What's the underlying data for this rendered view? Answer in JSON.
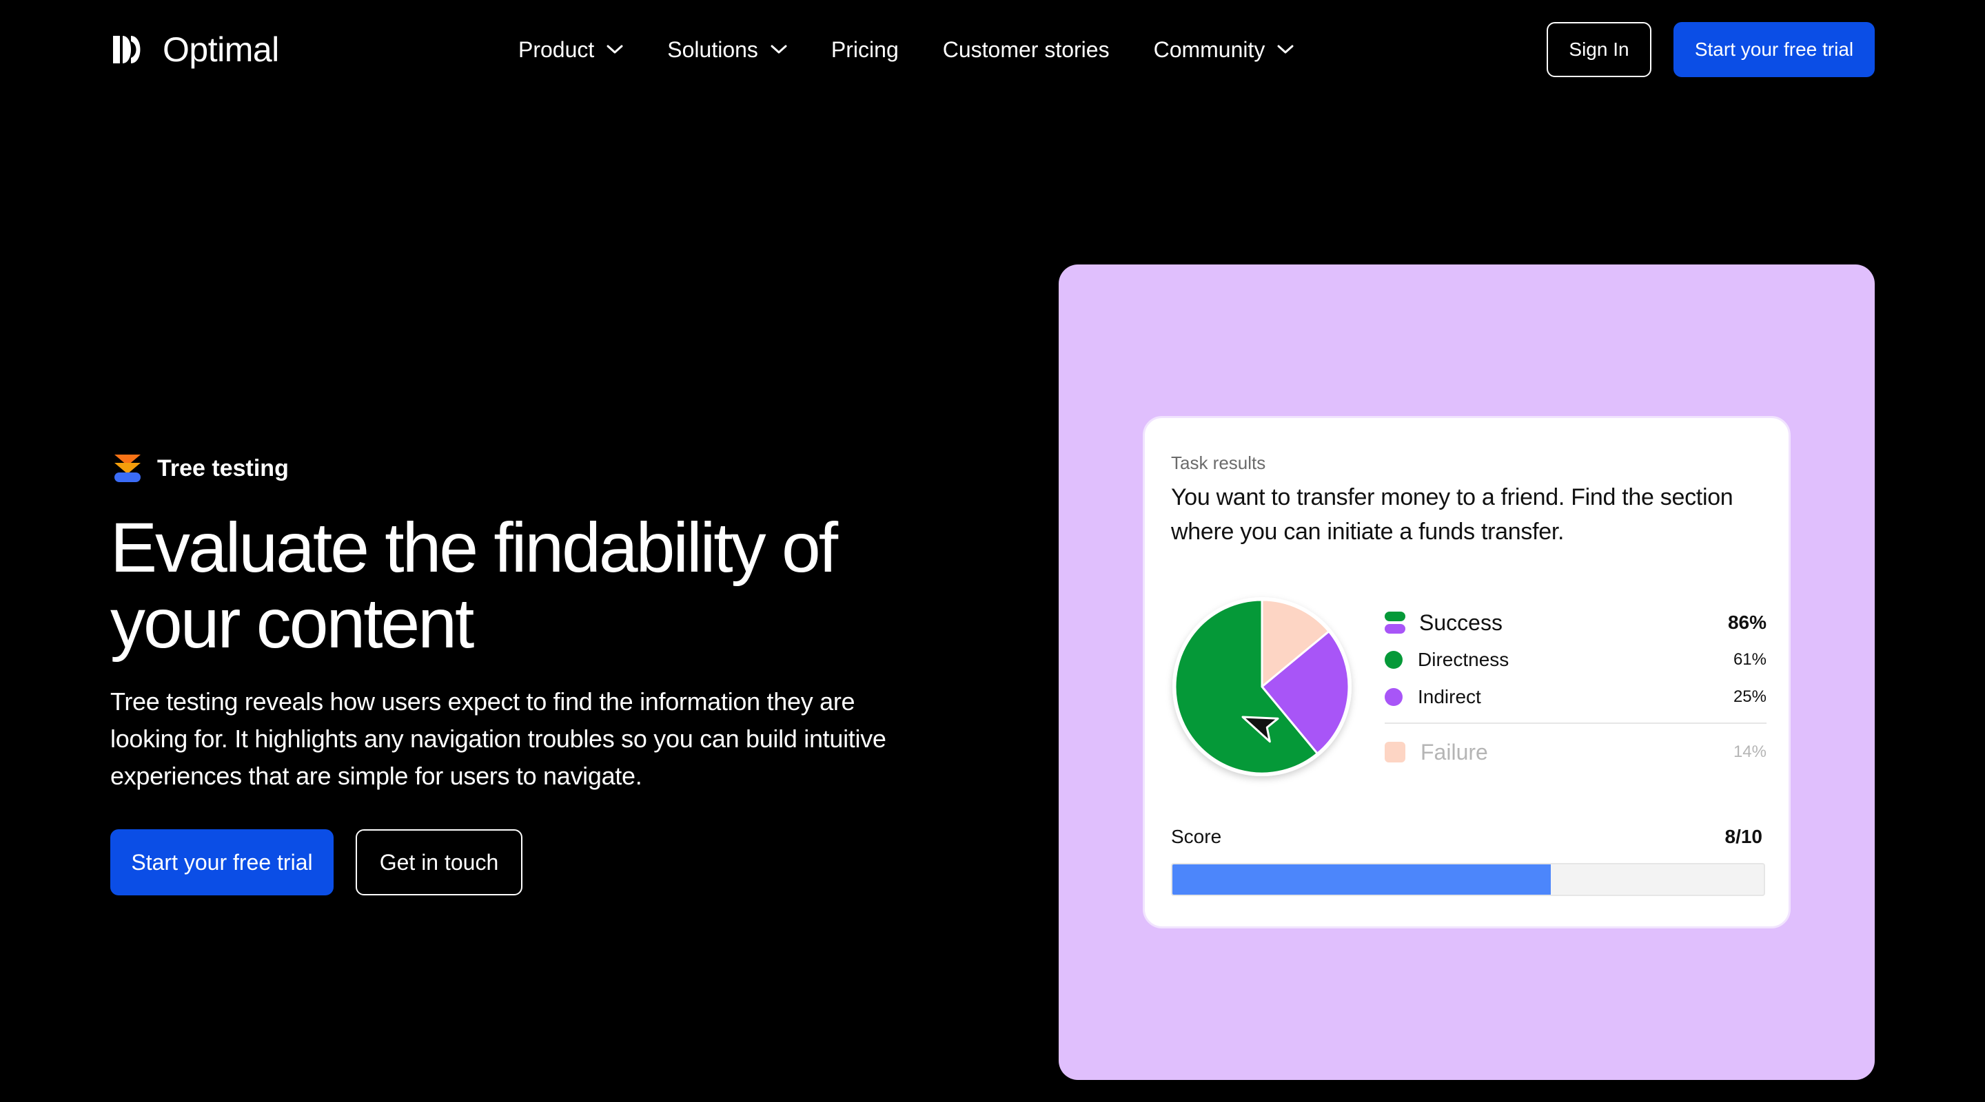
{
  "brand": {
    "name": "Optimal"
  },
  "nav": {
    "items": [
      {
        "label": "Product",
        "has_dropdown": true
      },
      {
        "label": "Solutions",
        "has_dropdown": true
      },
      {
        "label": "Pricing",
        "has_dropdown": false
      },
      {
        "label": "Customer stories",
        "has_dropdown": false
      },
      {
        "label": "Community",
        "has_dropdown": true
      }
    ],
    "sign_in": "Sign In",
    "trial": "Start your free trial"
  },
  "hero": {
    "badge": "Tree testing",
    "title": "Evaluate the findability of your content",
    "description": "Tree testing reveals how users expect to find the information they are looking for. It highlights any navigation troubles so you can build intuitive experiences that are simple for users to navigate.",
    "cta_primary": "Start your free trial",
    "cta_secondary": "Get in touch"
  },
  "task_card": {
    "label": "Task results",
    "question": "You want to transfer money to a friend. Find the section where you can initiate a funds transfer.",
    "legend": {
      "success": {
        "label": "Success",
        "value": "86%"
      },
      "directness": {
        "label": "Directness",
        "value": "61%"
      },
      "indirect": {
        "label": "Indirect",
        "value": "25%"
      },
      "failure": {
        "label": "Failure",
        "value": "14%"
      }
    },
    "score": {
      "label": "Score",
      "value": "8/10",
      "fraction": 0.64
    }
  },
  "chart_data": {
    "type": "pie",
    "categories": [
      "Directness",
      "Indirect",
      "Failure"
    ],
    "values": [
      61,
      25,
      14
    ],
    "colors": [
      "#059938",
      "#a855f7",
      "#fdd5c4"
    ]
  },
  "colors": {
    "accent": "#0b4ee6",
    "panel": "#e0bffd",
    "score_bar": "#4c86fb"
  },
  "icons": {
    "logo": "optimal-logo-icon",
    "badge": "tree-testing-icon",
    "cursor": "cursor-arrow-icon",
    "dropdown": "chevron-down-icon"
  }
}
